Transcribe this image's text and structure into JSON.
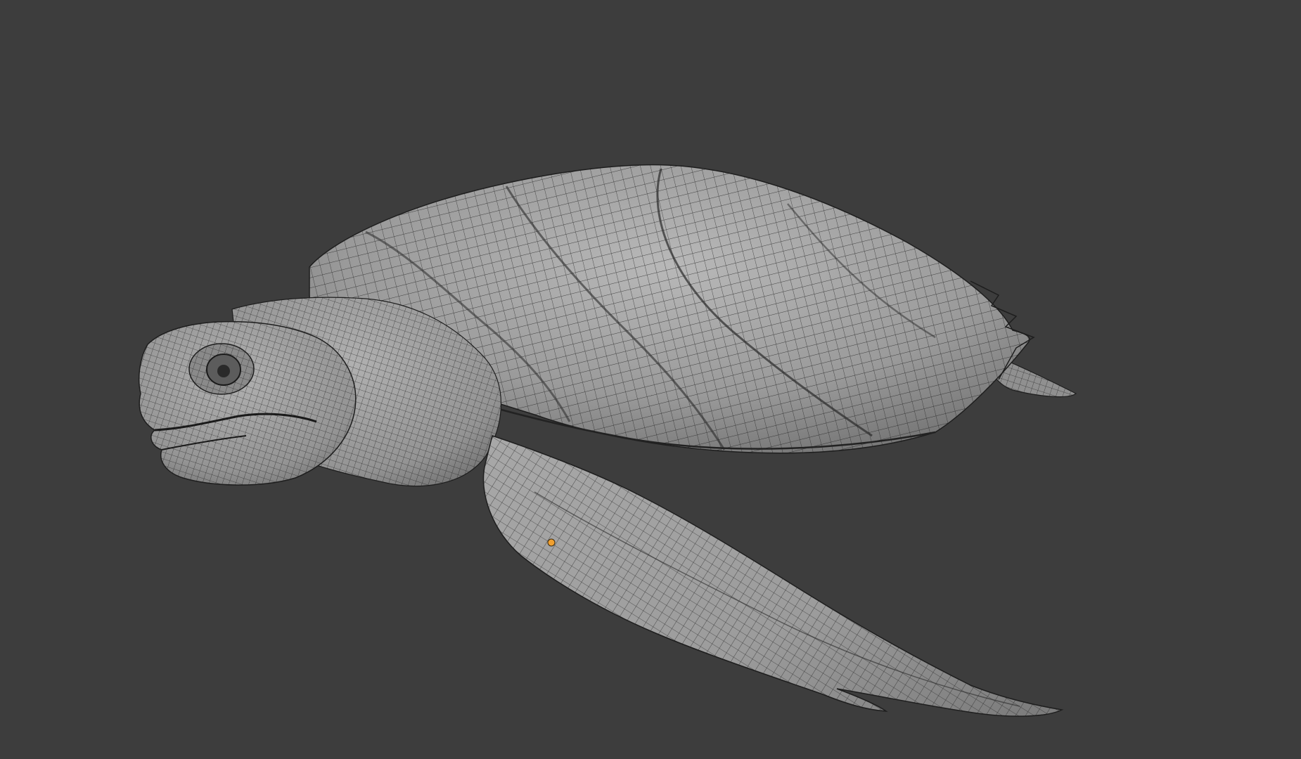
{
  "viewport": {
    "background_color": "#3d3d3d",
    "mesh_fill_color": "#8c8c8c",
    "mesh_fill_highlight": "#b4b4b4",
    "wireframe_color": "#1e1e1e",
    "object_origin_color": "#f0a030"
  },
  "scene": {
    "object": "turtle-mesh",
    "parts": [
      "shell",
      "head",
      "eye",
      "neck",
      "front-flipper",
      "rear-flipper"
    ]
  }
}
